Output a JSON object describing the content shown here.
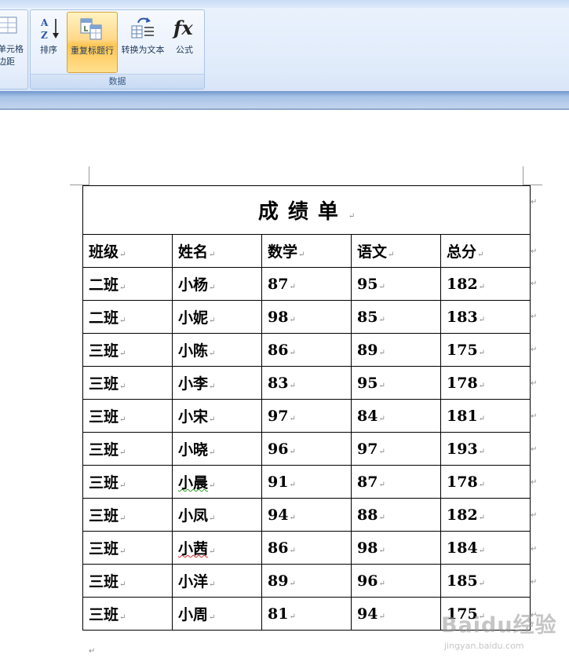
{
  "ribbon": {
    "left_group": {
      "label_line1": "单元格",
      "label_line2": "边距"
    },
    "data_group": {
      "title": "数据",
      "buttons": [
        {
          "id": "sort",
          "label": "排序",
          "icon": "sort-az-icon"
        },
        {
          "id": "repeat_header",
          "label": "重复标题行",
          "icon": "repeat-header-rows-icon",
          "active": true
        },
        {
          "id": "convert_to_text",
          "label": "转换为文本",
          "icon": "convert-to-text-icon"
        },
        {
          "id": "formula",
          "label": "公式",
          "icon": "formula-fx-icon"
        }
      ]
    },
    "colors": {
      "accent_active": "#ffc552",
      "ribbon_bg": "#e3edfb"
    }
  },
  "document": {
    "table_title": "成绩单",
    "headers": [
      "班级",
      "姓名",
      "数学",
      "语文",
      "总分"
    ],
    "rows": [
      [
        "二班",
        "小杨",
        "87",
        "95",
        "182"
      ],
      [
        "二班",
        "小妮",
        "98",
        "85",
        "183"
      ],
      [
        "三班",
        "小陈",
        "86",
        "89",
        "175"
      ],
      [
        "三班",
        "小李",
        "83",
        "95",
        "178"
      ],
      [
        "三班",
        "小宋",
        "97",
        "84",
        "181"
      ],
      [
        "三班",
        "小晓",
        "96",
        "97",
        "193"
      ],
      [
        "三班",
        "小晨",
        "91",
        "87",
        "178"
      ],
      [
        "三班",
        "小凤",
        "94",
        "88",
        "182"
      ],
      [
        "三班",
        "小茜",
        "86",
        "98",
        "184"
      ],
      [
        "三班",
        "小洋",
        "89",
        "96",
        "185"
      ],
      [
        "三班",
        "小周",
        "81",
        "94",
        "175"
      ]
    ],
    "paragraph_mark": "↵"
  },
  "watermark": {
    "text": "Baidu经验",
    "url_text": "jingyan.baidu.com"
  }
}
